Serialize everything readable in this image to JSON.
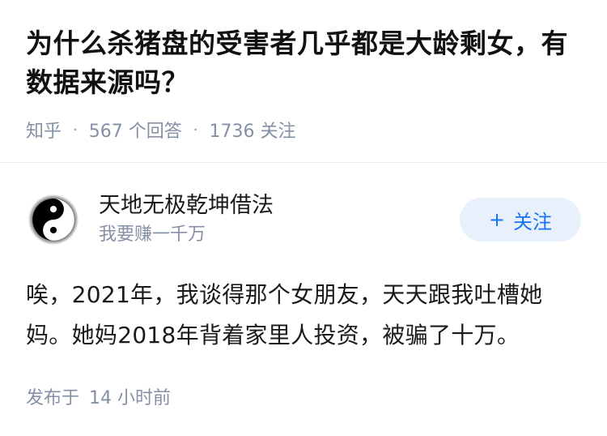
{
  "question": {
    "title": "为什么杀猪盘的受害者几乎都是大龄剩女，有数据来源吗？",
    "source": "知乎",
    "answers_count": "567 个回答",
    "followers_count": "1736 关注",
    "separator": "·"
  },
  "answer": {
    "author_name": "天地无极乾坤借法",
    "author_bio": "我要赚一千万",
    "follow_label": "关注",
    "follow_plus": "+",
    "body": "唉，2021年，我谈得那个女朋友，天天跟我吐槽她妈。她妈2018年背着家里人投资，被骗了十万。",
    "published_prefix": "发布于",
    "published_time": "14 小时前"
  },
  "colors": {
    "accent": "#1772f6",
    "follow_bg": "#e8f1fb",
    "meta_gray": "#8590a6"
  },
  "icons": {
    "avatar": "yin-yang-icon"
  }
}
